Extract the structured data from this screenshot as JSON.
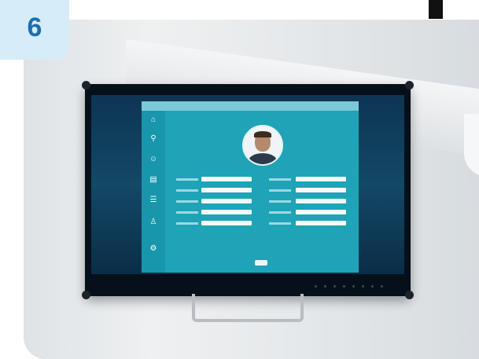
{
  "badge": {
    "number": "6"
  },
  "colors": {
    "badge_bg": "#d6ecf9",
    "badge_text": "#1a6fb0",
    "app_bg": "#1fa3b6"
  },
  "icons": [
    "home-icon",
    "search-icon",
    "user-icon",
    "file-icon",
    "list-icon",
    "person-icon",
    "settings-icon"
  ]
}
